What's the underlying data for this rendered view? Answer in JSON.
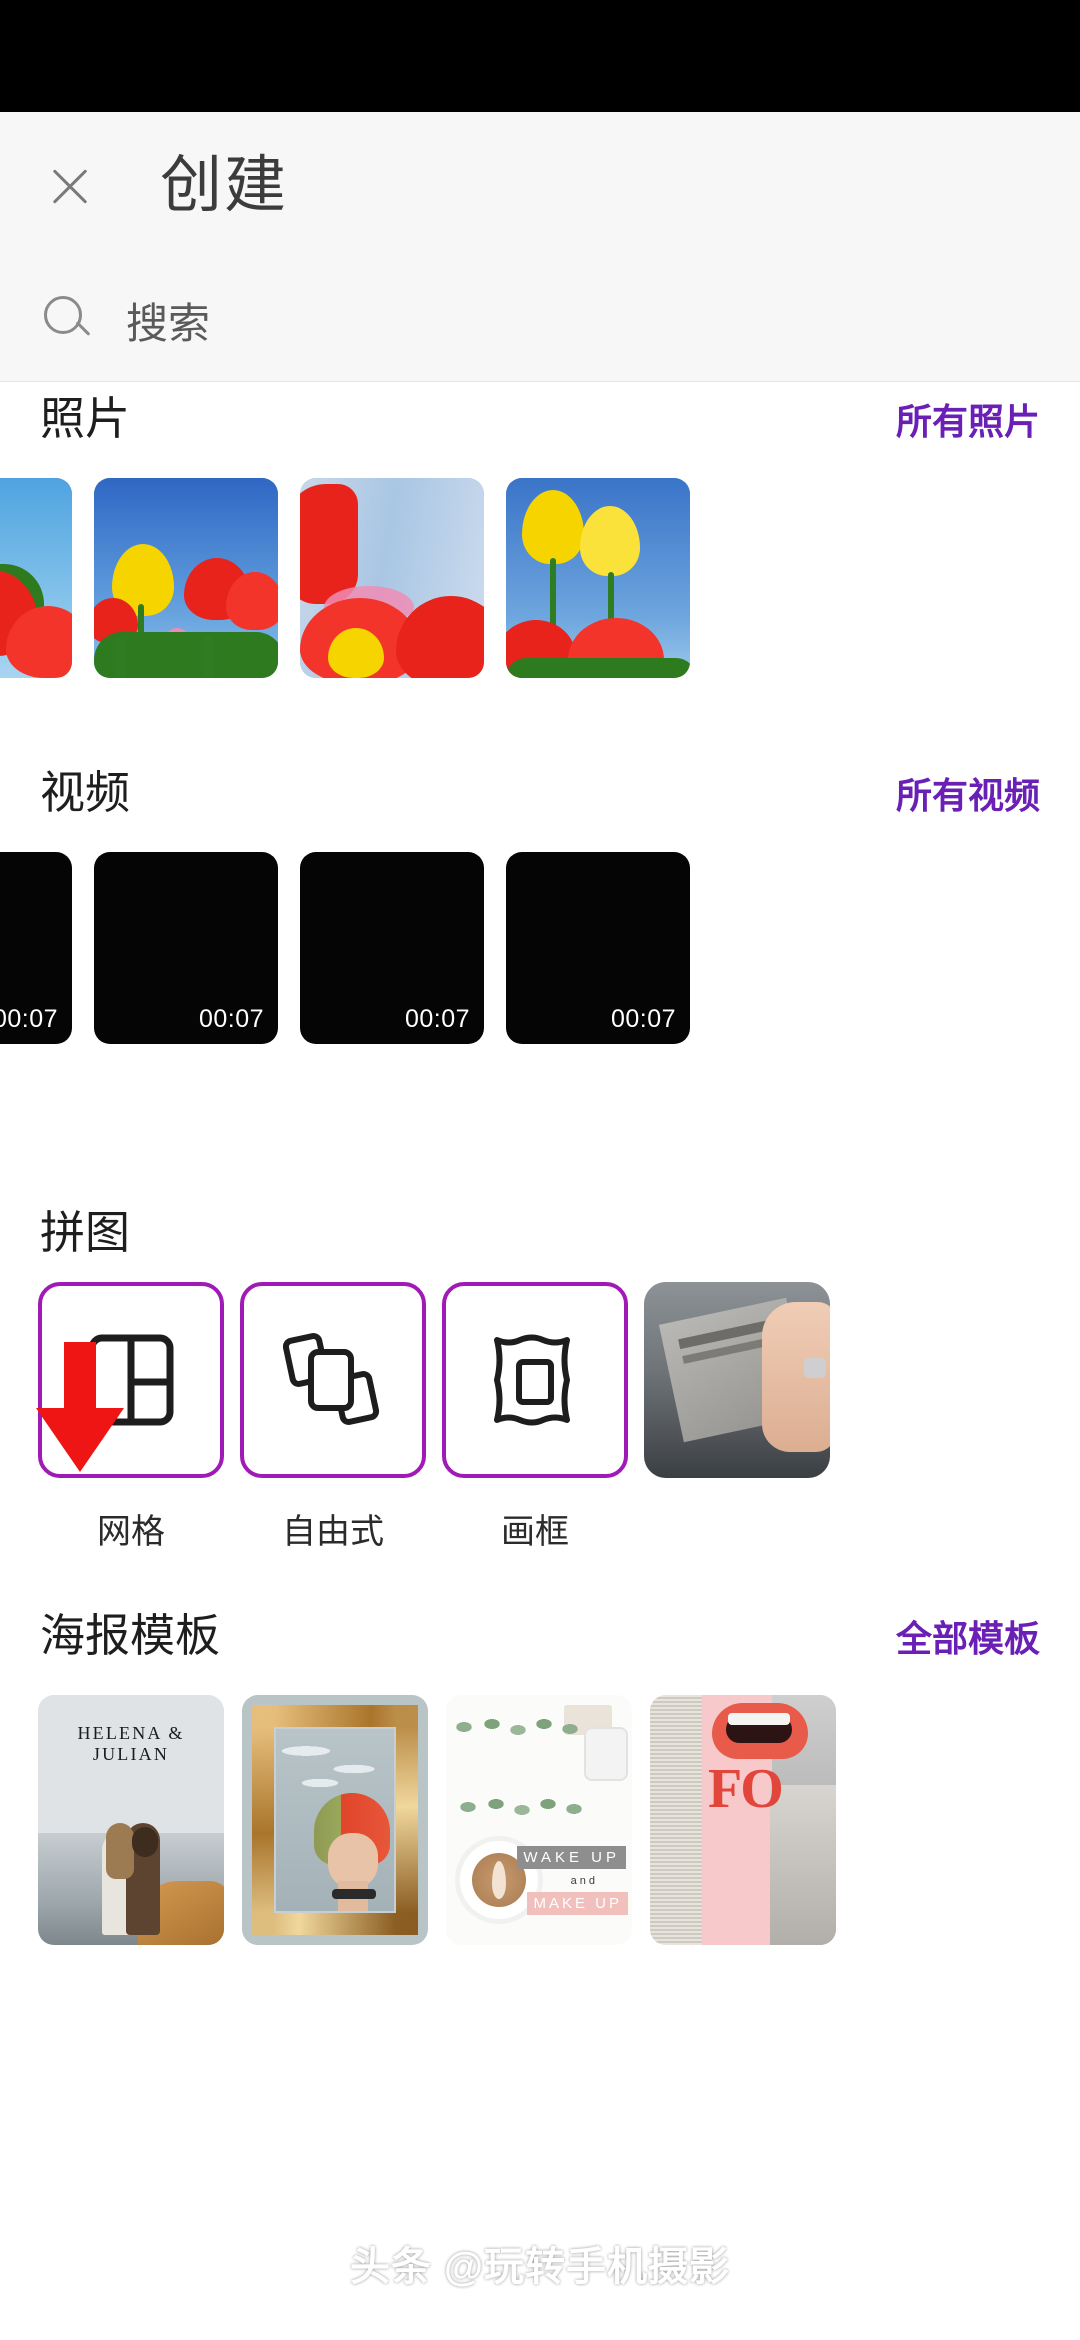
{
  "statusbar": {
    "present": true
  },
  "header": {
    "title": "创建",
    "close_icon": "close-icon"
  },
  "search": {
    "icon": "search-icon",
    "placeholder": "搜索"
  },
  "colors": {
    "accent_link": "#6a1fb5",
    "card_border": "#a01ab5",
    "annotation_arrow": "#f01515",
    "header_bg": "#f7f7f7",
    "title_text": "#1e1e1e"
  },
  "sections": {
    "photos": {
      "title": "照片",
      "link": "所有照片",
      "items": [
        {
          "alt": "yellow and red tulips with trees"
        },
        {
          "alt": "tulip field under blue sky"
        },
        {
          "alt": "blurred red and pink tulips"
        },
        {
          "alt": "two yellow tulips with red tulips"
        }
      ]
    },
    "videos": {
      "title": "视频",
      "link": "所有视频",
      "items": [
        {
          "duration": "00:07"
        },
        {
          "duration": "00:07"
        },
        {
          "duration": "00:07"
        },
        {
          "duration": "00:07"
        }
      ]
    },
    "collage": {
      "title": "拼图",
      "items": [
        {
          "label": "网格",
          "icon": "grid-layout-icon"
        },
        {
          "label": "自由式",
          "icon": "stacked-cards-icon"
        },
        {
          "label": "画框",
          "icon": "picture-frame-icon"
        },
        {
          "label": "",
          "icon": "photo-thumbnail"
        }
      ]
    },
    "templates": {
      "title": "海报模板",
      "link": "全部模板",
      "items": [
        {
          "caption": "HELENA & JULIAN"
        },
        {
          "caption": ""
        },
        {
          "caption_line1": "WAKE UP",
          "caption_line2": "and",
          "caption_line3": "MAKE UP"
        },
        {
          "caption": "FO"
        }
      ]
    }
  },
  "annotation": {
    "arrow": "down-arrow-annotation"
  },
  "watermark": {
    "text": "头条 @玩转手机摄影"
  }
}
